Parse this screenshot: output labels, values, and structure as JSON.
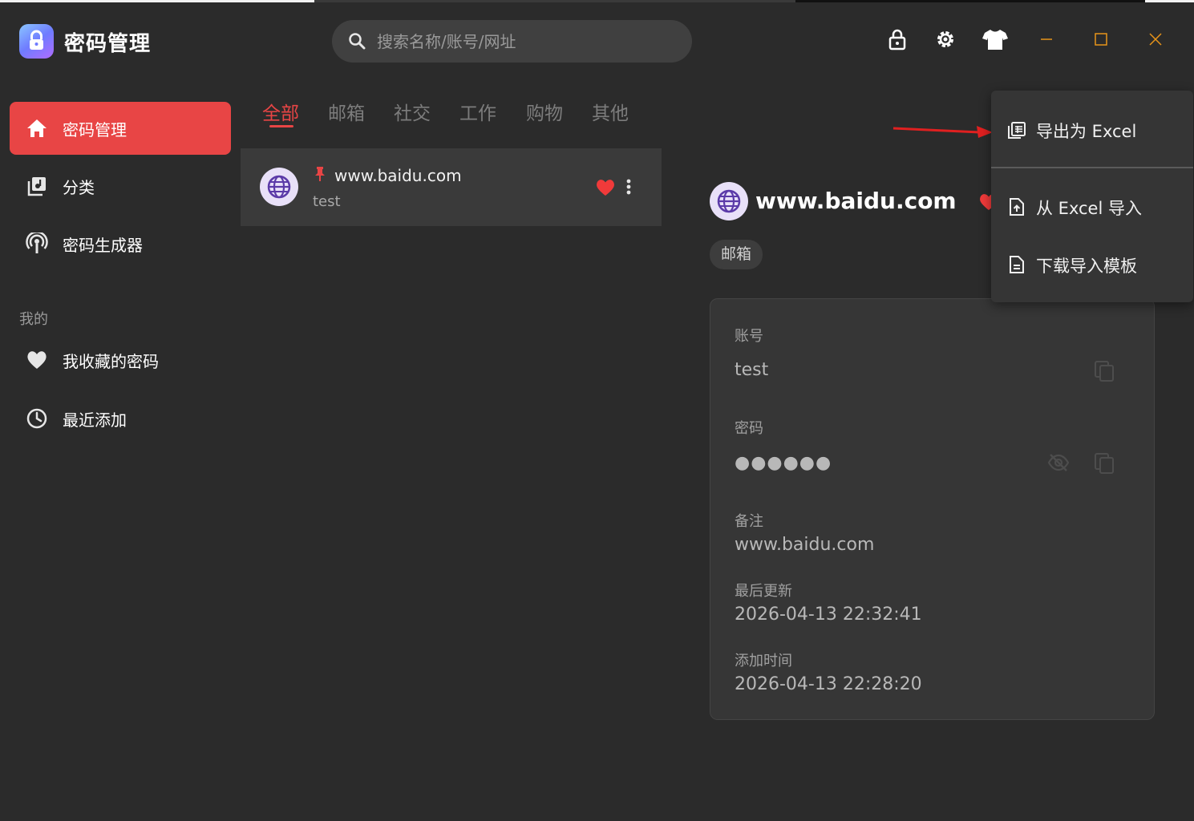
{
  "app": {
    "title": "密码管理"
  },
  "search": {
    "placeholder": "搜索名称/账号/网址"
  },
  "sidebar": {
    "items": [
      {
        "label": "密码管理",
        "icon": "home-icon",
        "active": true
      },
      {
        "label": "分类",
        "icon": "category-icon",
        "active": false
      },
      {
        "label": "密码生成器",
        "icon": "generator-icon",
        "active": false
      }
    ],
    "section_label": "我的",
    "my_items": [
      {
        "label": "我收藏的密码",
        "icon": "heart-icon"
      },
      {
        "label": "最近添加",
        "icon": "clock-icon"
      }
    ]
  },
  "tabs": [
    {
      "label": "全部",
      "active": true
    },
    {
      "label": "邮箱",
      "active": false
    },
    {
      "label": "社交",
      "active": false
    },
    {
      "label": "工作",
      "active": false
    },
    {
      "label": "购物",
      "active": false
    },
    {
      "label": "其他",
      "active": false
    }
  ],
  "list": [
    {
      "title": "www.baidu.com",
      "subtitle": "test",
      "pinned": true,
      "favorite": true
    }
  ],
  "detail": {
    "title": "www.baidu.com",
    "category": "邮箱",
    "fields": {
      "account_label": "账号",
      "account_value": "test",
      "password_label": "密码",
      "password_value": "●●●●●●",
      "note_label": "备注",
      "note_value": "www.baidu.com",
      "updated_label": "最后更新",
      "updated_value": "2026-04-13 22:32:41",
      "added_label": "添加时间",
      "added_value": "2026-04-13 22:28:20"
    }
  },
  "menu": {
    "items": [
      {
        "label": "导出为 Excel",
        "icon": "excel-export-icon"
      },
      {
        "label": "从 Excel 导入",
        "icon": "file-upload-icon"
      },
      {
        "label": "下载导入模板",
        "icon": "document-icon"
      }
    ]
  },
  "colors": {
    "accent": "#e84545",
    "background": "#2b2b2b",
    "window_controls": "#e8951a"
  }
}
